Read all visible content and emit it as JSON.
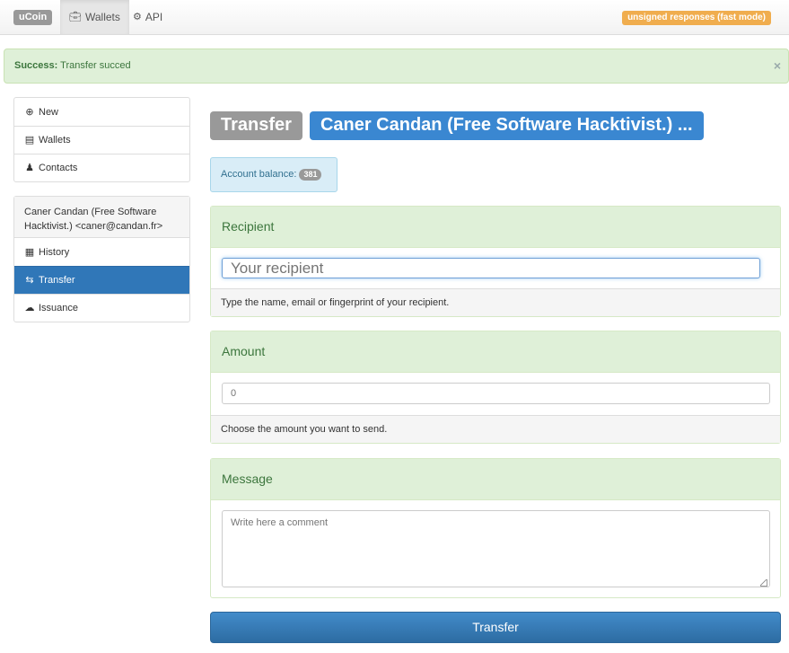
{
  "navbar": {
    "brand": "uCoin",
    "tabs": [
      {
        "label": "Wallets",
        "icon": "briefcase-icon",
        "active": true
      },
      {
        "label": "API",
        "icon": "gear-icon",
        "active": false
      }
    ],
    "mode_badge": "unsigned responses (fast mode)"
  },
  "alert": {
    "strong": "Success:",
    "message": "Transfer succed",
    "close": "×"
  },
  "sidebar": {
    "menu": [
      {
        "label": "New",
        "icon": "plus-circle-icon"
      },
      {
        "label": "Wallets",
        "icon": "credit-card-icon"
      },
      {
        "label": "Contacts",
        "icon": "user-icon"
      }
    ],
    "account_header": "Caner Candan (Free Software Hacktivist.) <caner@candan.fr>",
    "account_menu": [
      {
        "label": "History",
        "icon": "calendar-icon",
        "active": false
      },
      {
        "label": "Transfer",
        "icon": "transfer-icon",
        "active": true
      },
      {
        "label": "Issuance",
        "icon": "cloud-download-icon",
        "active": false
      }
    ]
  },
  "main": {
    "title": "Transfer",
    "account_name": "Caner Candan (Free Software Hacktivist.) ...",
    "balance_label": "Account balance:",
    "balance_value": "381",
    "recipient": {
      "heading": "Recipient",
      "placeholder": "Your recipient",
      "help": "Type the name, email or fingerprint of your recipient."
    },
    "amount": {
      "heading": "Amount",
      "placeholder": "0",
      "help": "Choose the amount you want to send."
    },
    "message": {
      "heading": "Message",
      "placeholder": "Write here a comment"
    },
    "submit_label": "Transfer"
  },
  "colors": {
    "primary": "#3077b8",
    "success_bg": "#dff0d8",
    "info_bg": "#d9edf7",
    "warning": "#f0ad4e"
  }
}
